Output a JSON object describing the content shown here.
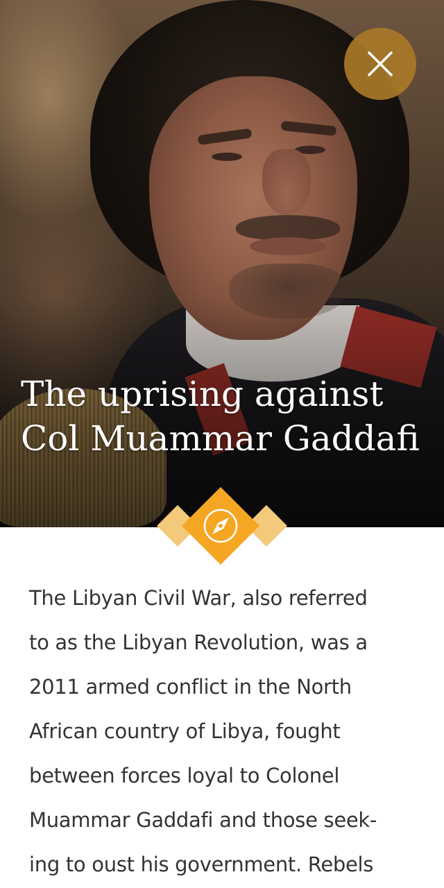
{
  "article": {
    "title_line1": "The uprising against",
    "title_line2": "Col Muammar Gaddafi",
    "body_lines": [
      "The Libyan Civil War, also referred",
      "to as the Libyan Revolution, was a",
      "2011 armed conflict in the North",
      "African country of Libya, fought",
      "between forces loyal to Colonel",
      "Muammar Gaddafi and those seek-",
      "ing to oust his government. Rebels"
    ]
  },
  "icons": {
    "close": "close-icon",
    "badge": "compass-icon"
  },
  "colors": {
    "accent": "#f5a623",
    "accent_light": "#f3c97c",
    "close_button": "#a87828",
    "body_text": "#333333"
  }
}
